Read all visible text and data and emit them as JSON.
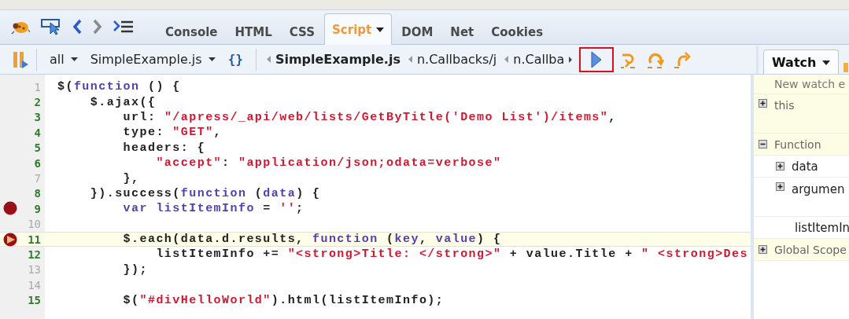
{
  "tabs": [
    {
      "label": "Console",
      "selected": false,
      "has_menu": false
    },
    {
      "label": "HTML",
      "selected": false,
      "has_menu": false
    },
    {
      "label": "CSS",
      "selected": false,
      "has_menu": false
    },
    {
      "label": "Script",
      "selected": true,
      "has_menu": true
    },
    {
      "label": "DOM",
      "selected": false,
      "has_menu": false
    },
    {
      "label": "Net",
      "selected": false,
      "has_menu": false
    },
    {
      "label": "Cookies",
      "selected": false,
      "has_menu": false
    }
  ],
  "script_toolbar": {
    "filter": "all",
    "file": "SimpleExample.js",
    "pretty_print": "{}",
    "breadcrumbs": [
      {
        "label": "SimpleExample.js",
        "selected": true
      },
      {
        "label": "n.Callbacks/j",
        "selected": false
      },
      {
        "label": "n.Callba",
        "selected": false
      }
    ],
    "resume_highlighted": true
  },
  "code": {
    "lines": [
      {
        "number": "1",
        "executable": false,
        "breakpoint": false,
        "current": false,
        "tokens": [
          {
            "kind": "plain",
            "text": "$("
          },
          {
            "kind": "keyword",
            "text": "function"
          },
          {
            "kind": "plain",
            "text": " () {"
          }
        ]
      },
      {
        "number": "2",
        "executable": true,
        "breakpoint": false,
        "current": false,
        "tokens": [
          {
            "kind": "plain",
            "text": "    $.ajax({"
          }
        ]
      },
      {
        "number": "3",
        "executable": true,
        "breakpoint": false,
        "current": false,
        "tokens": [
          {
            "kind": "plain",
            "text": "        url: "
          },
          {
            "kind": "string",
            "text": "\"/apress/_api/web/lists/GetByTitle('Demo List')/items\""
          },
          {
            "kind": "plain",
            "text": ","
          }
        ]
      },
      {
        "number": "4",
        "executable": true,
        "breakpoint": false,
        "current": false,
        "tokens": [
          {
            "kind": "plain",
            "text": "        type: "
          },
          {
            "kind": "string",
            "text": "\"GET\""
          },
          {
            "kind": "plain",
            "text": ","
          }
        ]
      },
      {
        "number": "5",
        "executable": true,
        "breakpoint": false,
        "current": false,
        "tokens": [
          {
            "kind": "plain",
            "text": "        headers: {"
          }
        ]
      },
      {
        "number": "6",
        "executable": true,
        "breakpoint": false,
        "current": false,
        "tokens": [
          {
            "kind": "string",
            "text": "            \"accept\""
          },
          {
            "kind": "plain",
            "text": ": "
          },
          {
            "kind": "string",
            "text": "\"application/json;odata=verbose\""
          }
        ]
      },
      {
        "number": "7",
        "executable": false,
        "breakpoint": false,
        "current": false,
        "tokens": [
          {
            "kind": "plain",
            "text": "        },"
          }
        ]
      },
      {
        "number": "8",
        "executable": true,
        "breakpoint": false,
        "current": false,
        "tokens": [
          {
            "kind": "plain",
            "text": "    }).success("
          },
          {
            "kind": "keyword",
            "text": "function"
          },
          {
            "kind": "plain",
            "text": " ("
          },
          {
            "kind": "keyword",
            "text": "data"
          },
          {
            "kind": "plain",
            "text": ") {"
          }
        ]
      },
      {
        "number": "9",
        "executable": true,
        "breakpoint": true,
        "current": false,
        "tokens": [
          {
            "kind": "keyword",
            "text": "        var listItemInfo"
          },
          {
            "kind": "plain",
            "text": " = "
          },
          {
            "kind": "string",
            "text": "''"
          },
          {
            "kind": "plain",
            "text": ";"
          }
        ]
      },
      {
        "number": "10",
        "executable": false,
        "breakpoint": false,
        "current": false
      },
      {
        "number": "11",
        "executable": true,
        "breakpoint": true,
        "current": true,
        "tokens": [
          {
            "kind": "plain",
            "text": "        $.each(data.d.results, "
          },
          {
            "kind": "keyword",
            "text": "function"
          },
          {
            "kind": "plain",
            "text": " ("
          },
          {
            "kind": "keyword",
            "text": "key"
          },
          {
            "kind": "plain",
            "text": ", "
          },
          {
            "kind": "keyword",
            "text": "value"
          },
          {
            "kind": "plain",
            "text": ") {"
          }
        ]
      },
      {
        "number": "12",
        "executable": true,
        "breakpoint": false,
        "current": false,
        "tokens": [
          {
            "kind": "plain",
            "text": "            listItemInfo += "
          },
          {
            "kind": "string",
            "text": "\"<strong>Title: </strong>\""
          },
          {
            "kind": "plain",
            "text": " + value.Title + "
          },
          {
            "kind": "string",
            "text": "\" <strong>Des"
          }
        ]
      },
      {
        "number": "13",
        "executable": false,
        "breakpoint": false,
        "current": false,
        "tokens": [
          {
            "kind": "plain",
            "text": "        });"
          }
        ]
      },
      {
        "number": "14",
        "executable": false,
        "breakpoint": false,
        "current": false
      },
      {
        "number": "15",
        "executable": true,
        "breakpoint": false,
        "current": false,
        "tokens": [
          {
            "kind": "plain",
            "text": "        $("
          },
          {
            "kind": "string",
            "text": "\"#divHelloWorld\""
          },
          {
            "kind": "plain",
            "text": ").html(listItemInfo);"
          }
        ]
      }
    ]
  },
  "watch": {
    "tab": "Watch",
    "new_watch": "New watch e",
    "items": [
      {
        "label": "this",
        "kind": "scope",
        "expanded": false
      },
      {
        "label": "Function",
        "kind": "scope",
        "expanded": true,
        "children": [
          {
            "label": "data",
            "kind": "object",
            "expanded": false
          },
          {
            "label": "argumen",
            "kind": "object",
            "expanded": false
          },
          {
            "label": "listItemIn",
            "kind": "value"
          }
        ]
      },
      {
        "label": "Global Scope",
        "kind": "scope",
        "expanded": false
      }
    ]
  }
}
